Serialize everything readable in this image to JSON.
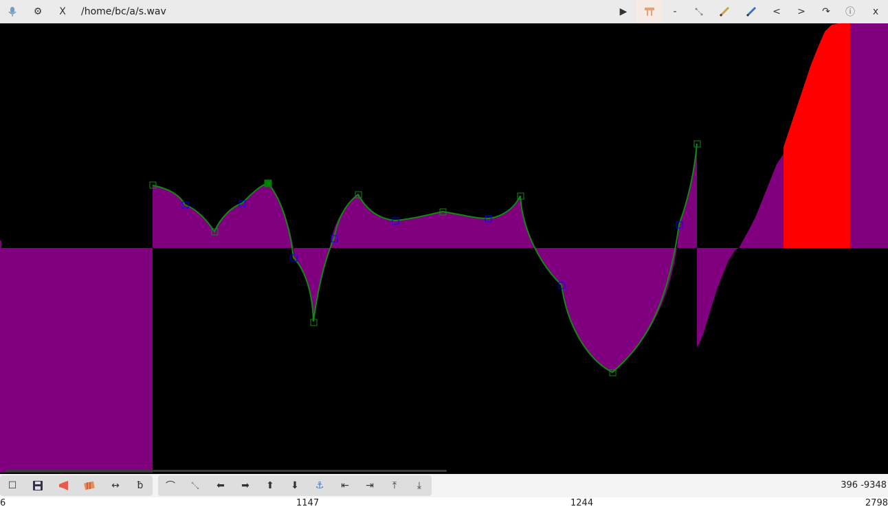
{
  "topbar": {
    "file_path": "/home/bc/a/s.wav",
    "close_x_label": "X",
    "play_label": "▶",
    "minus_label": "-",
    "prev_label": "<",
    "next_label": ">",
    "redo_label": "↷",
    "info_label": "ⓘ",
    "exit_label": "x"
  },
  "bottombar": {
    "coords": "396 -9348"
  },
  "ruler": {
    "ticks": [
      "6",
      "1147",
      "1244",
      "2798"
    ]
  },
  "colors": {
    "waveform_fill": "#800080",
    "waveform_selected": "#ff0000",
    "curve": "#0f8a0f",
    "control_point_handle": "#0000ff",
    "anchor_point": "#008000",
    "background": "#000000"
  },
  "icons": [
    "mic-icon",
    "gear-icon",
    "close-icon",
    "play-icon",
    "scissors-icon",
    "minus-icon",
    "line-icon",
    "pencil-icon",
    "pencil-blue-icon",
    "prev-icon",
    "next-icon",
    "redo-icon",
    "info-icon",
    "exit-icon",
    "new-icon",
    "save-icon",
    "megaphone-icon",
    "accordion-icon",
    "resize-horizontal-icon",
    "text-b-icon",
    "curve-icon",
    "line-small-icon",
    "arrow-left-icon",
    "arrow-right-icon",
    "arrow-up-icon",
    "arrow-down-icon",
    "anchor-icon",
    "to-start-icon",
    "to-end-icon",
    "to-top-icon",
    "to-bottom-icon"
  ]
}
